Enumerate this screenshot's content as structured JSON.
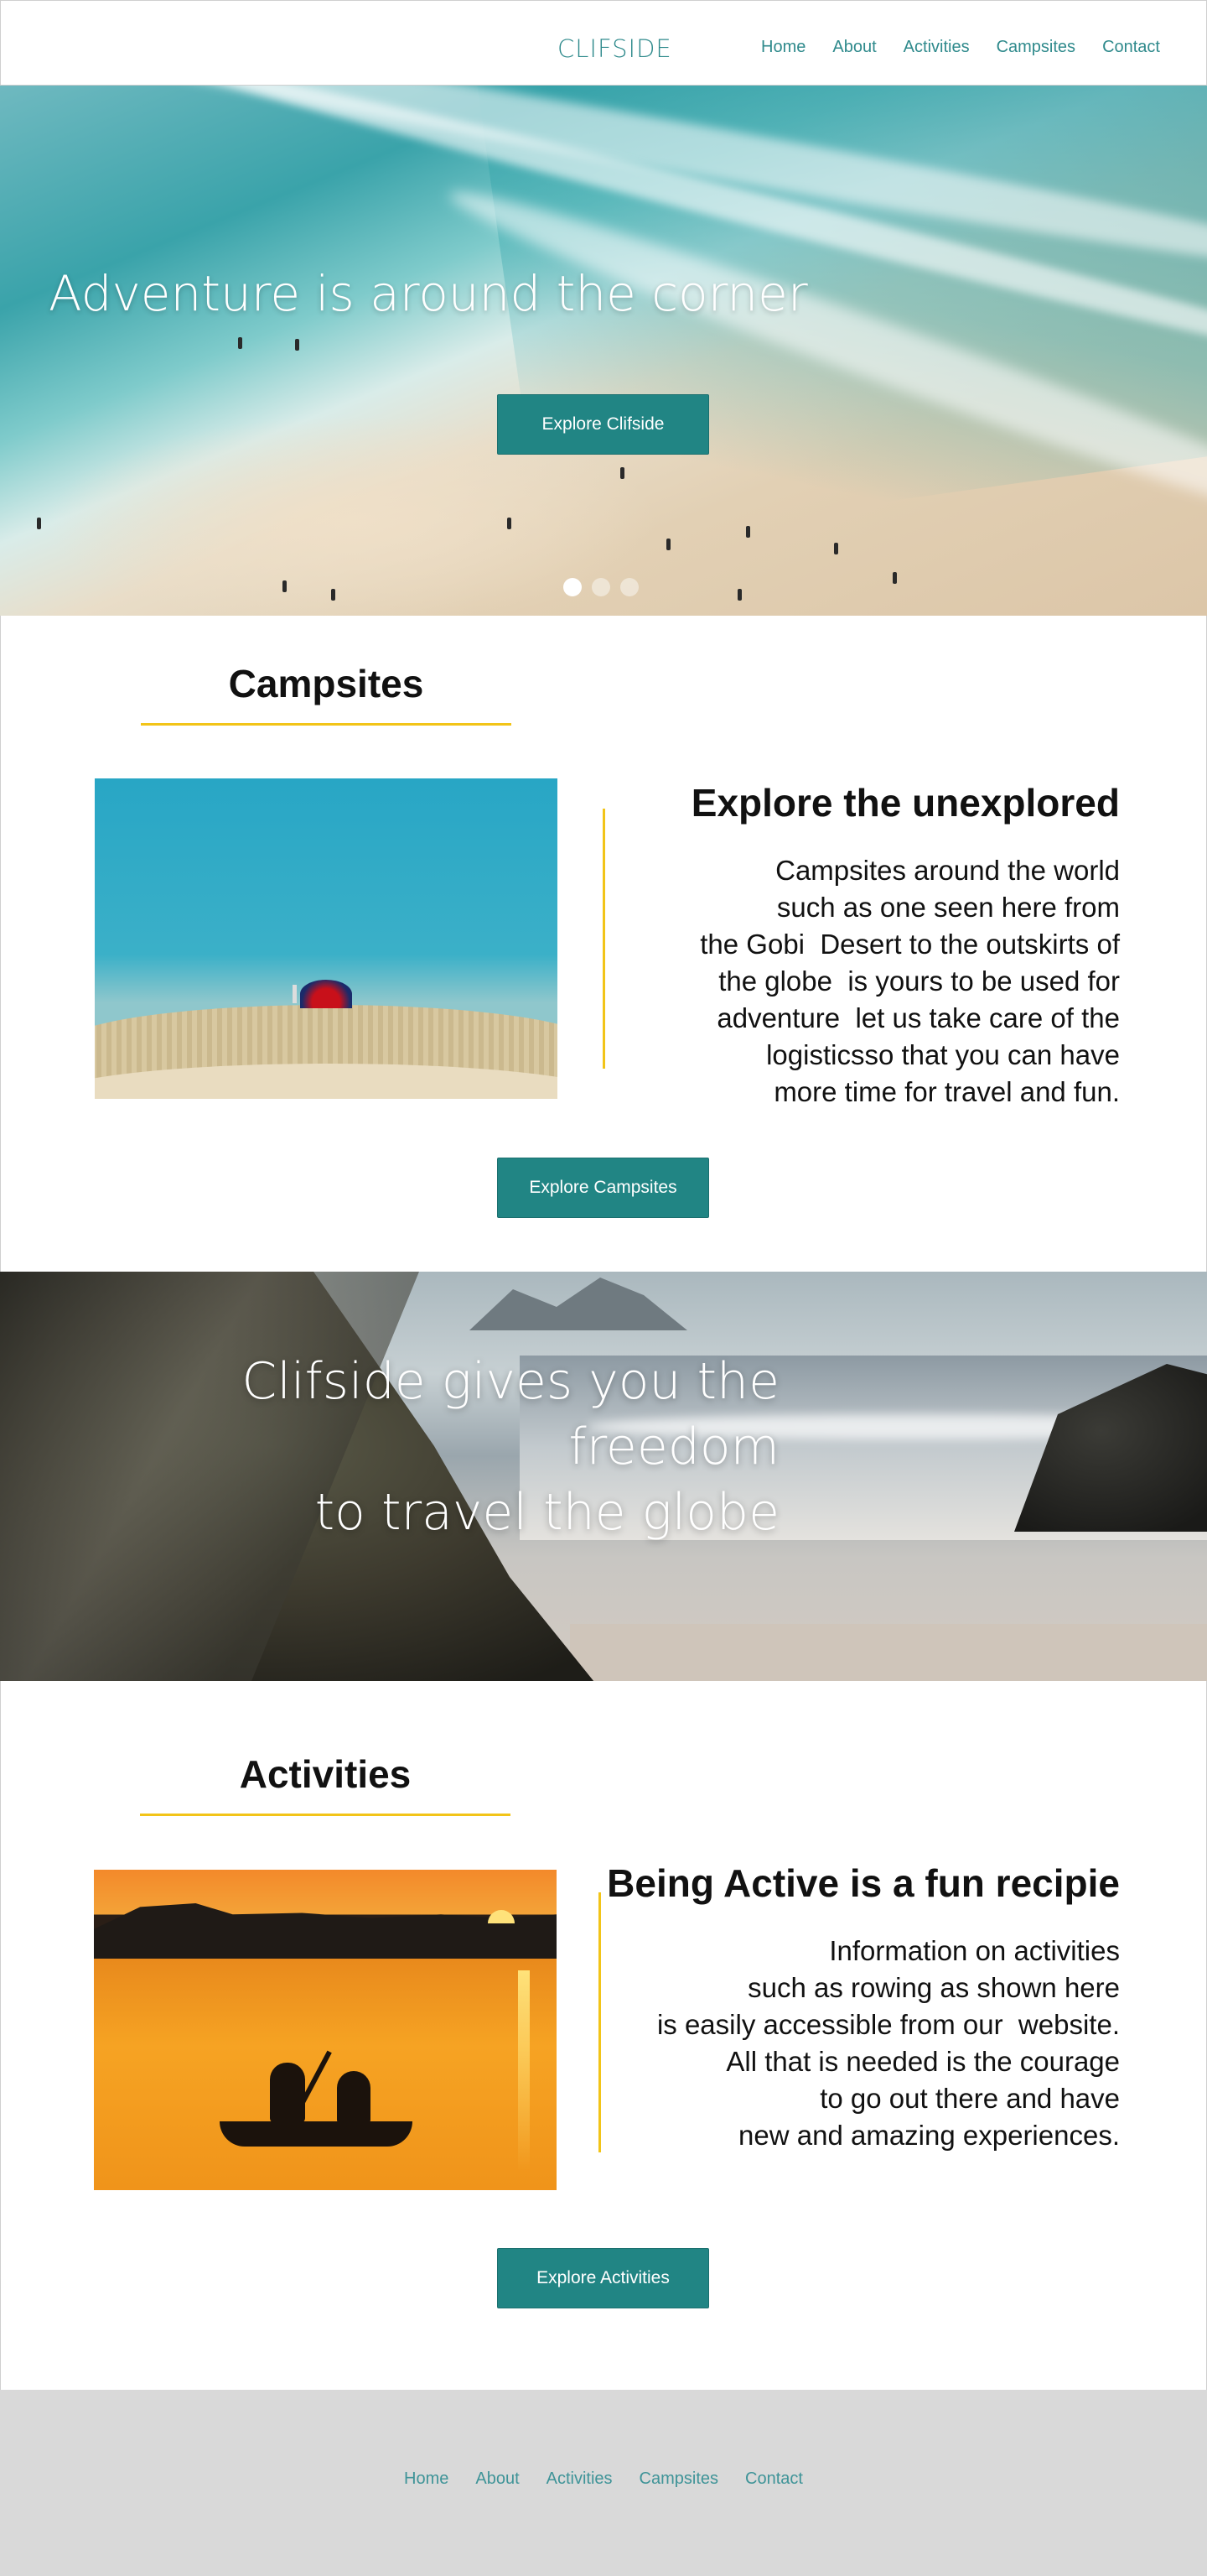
{
  "header": {
    "brand": "CLIFSIDE",
    "nav": [
      "Home",
      "About",
      "Activities",
      "Campsites",
      "Contact"
    ]
  },
  "hero": {
    "title": "Adventure is around the corner",
    "button": "Explore Clifside",
    "carousel": {
      "slides": 3,
      "active_index": 0
    }
  },
  "campsites": {
    "section_title": "Campsites",
    "heading": "Explore the unexplored",
    "body_lines": [
      "Campsites around the world",
      "such as one seen here from",
      "the Gobi  Desert to the outskirts of",
      "the globe  is yours to be used for",
      "adventure  let us take care of the",
      "logisticsso that you can have",
      "more time for travel and fun."
    ],
    "button": "Explore Campsites"
  },
  "banner": {
    "lines": [
      "Clifside gives you the freedom",
      "to travel the globe"
    ]
  },
  "activities": {
    "section_title": "Activities",
    "heading": "Being Active is a fun recipie",
    "body_lines": [
      "Information on activities",
      "such as rowing as shown here",
      "is easily accessible from our  website.",
      "All that is needed is the courage",
      "to go out there and have",
      "new and amazing experiences."
    ],
    "button": "Explore Activities"
  },
  "footer": {
    "nav": [
      "Home",
      "About",
      "Activities",
      "Campsites",
      "Contact"
    ]
  },
  "colors": {
    "accent": "#218584",
    "nav_text": "#2f8a8c",
    "rule": "#f2c418",
    "footer_bg": "#d9d9d9"
  }
}
